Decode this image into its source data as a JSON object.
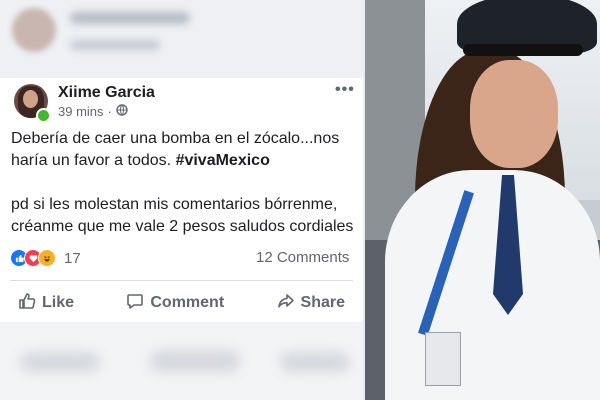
{
  "post": {
    "author": "Xiime Garcia",
    "time": "39 mins",
    "menu": "•••",
    "text_line1": "Debería de caer una bomba en el zócalo...nos haría un favor a todos.",
    "hashtag": "#vivaMexico",
    "text_line2": "pd si les molestan mis comentarios bórrenme, créanme que me vale 2 pesos  saludos cordiales",
    "reaction_count": "17",
    "comments_count": "12 Comments",
    "reactions": [
      "like",
      "love",
      "haha"
    ]
  },
  "actions": {
    "like_label": "Like",
    "comment_label": "Comment",
    "share_label": "Share"
  },
  "icons": {
    "privacy": "globe-icon",
    "like": "thumbs-up-icon",
    "comment": "comment-icon",
    "share": "share-arrow-icon"
  },
  "colors": {
    "facebook_blue": "#1877f2",
    "online_green": "#42b72a",
    "text_primary": "#1c1e21",
    "text_secondary": "#606770"
  }
}
